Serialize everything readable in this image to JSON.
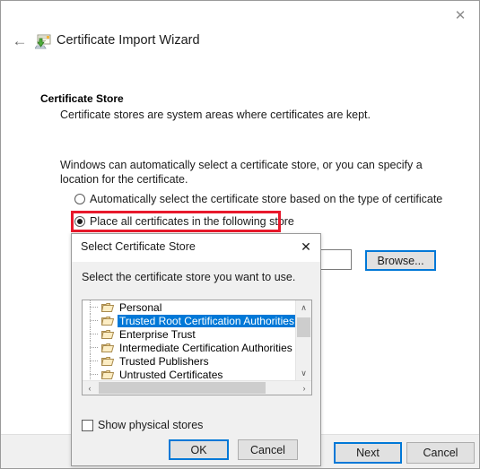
{
  "window": {
    "title": "Certificate Import Wizard",
    "close_label": "✕",
    "back_label": "←",
    "wizard_icon": "certificate-import-icon"
  },
  "page": {
    "heading": "Certificate Store",
    "subheading": "Certificate stores are system areas where certificates are kept.",
    "body_text": "Windows can automatically select a certificate store, or you can specify a location for the certificate."
  },
  "options": {
    "auto": {
      "label": "Automatically select the certificate store based on the type of certificate",
      "selected": false
    },
    "manual": {
      "label": "Place all certificates in the following store",
      "selected": true,
      "highlight_color": "#e8192c"
    }
  },
  "store_field": {
    "value": "",
    "placeholder": ""
  },
  "buttons": {
    "browse": "Browse...",
    "next": "Next",
    "cancel": "Cancel"
  },
  "dialog": {
    "title": "Select Certificate Store",
    "close_label": "✕",
    "prompt": "Select the certificate store you want to use.",
    "tree": {
      "items": [
        {
          "label": "Personal",
          "selected": false
        },
        {
          "label": "Trusted Root Certification Authorities",
          "selected": true
        },
        {
          "label": "Enterprise Trust",
          "selected": false
        },
        {
          "label": "Intermediate Certification Authorities",
          "selected": false
        },
        {
          "label": "Trusted Publishers",
          "selected": false
        },
        {
          "label": "Untrusted Certificates",
          "selected": false
        }
      ],
      "selection_color": "#0078d7",
      "vscroll": {
        "up": "∧",
        "down": "∨"
      },
      "hscroll": {
        "left": "‹",
        "right": "›"
      }
    },
    "show_physical_stores": {
      "label": "Show physical stores",
      "checked": false
    },
    "ok": "OK",
    "cancel": "Cancel"
  }
}
